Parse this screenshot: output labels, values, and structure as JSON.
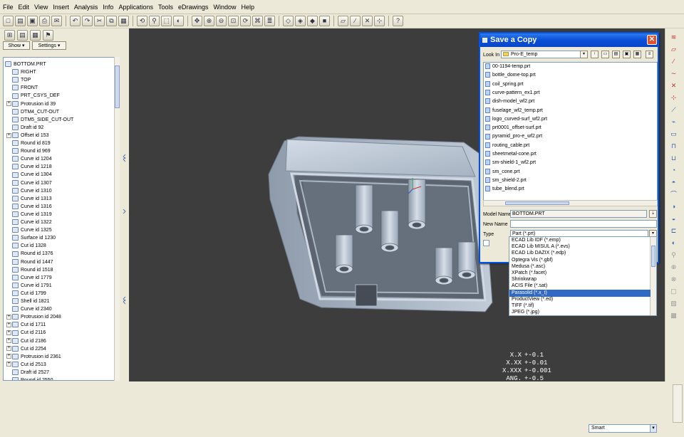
{
  "menu": [
    "File",
    "Edit",
    "View",
    "Insert",
    "Analysis",
    "Info",
    "Applications",
    "Tools",
    "eDrawings",
    "Window",
    "Help"
  ],
  "toolbar": {
    "icons": [
      "new-icon",
      "open-icon",
      "save-icon",
      "print-icon",
      "email-icon",
      "undo-icon",
      "redo-icon",
      "cut-icon",
      "copy-icon",
      "paste-icon",
      "regenerate-icon",
      "find-icon",
      "select-icon",
      "repaint-icon",
      "spin-center-icon",
      "zoom-in-icon",
      "zoom-out-icon",
      "refit-icon",
      "orient-icon",
      "saved-views-icon",
      "layers-icon",
      "wireframe-icon",
      "hidden-line-icon",
      "no-hidden-icon",
      "shading-icon",
      "datum-planes-icon",
      "datum-axes-icon",
      "datum-points-icon",
      "csys-icon",
      "whats-this-icon"
    ],
    "glyphs": [
      "□",
      "▤",
      "▣",
      "⎙",
      "✉",
      "↶",
      "↷",
      "✂",
      "⧉",
      "▦",
      "⟲",
      "⚲",
      "⬚",
      "◐",
      "✥",
      "⊕",
      "⊖",
      "⊡",
      "⟳",
      "⌘",
      "≣",
      "◇",
      "◈",
      "◆",
      "■",
      "▱",
      "∕",
      "✕",
      "⊹",
      "?"
    ]
  },
  "left_tools": [
    "⊞",
    "▤",
    "▦",
    "⚑"
  ],
  "show_button": "Show ▾",
  "settings_button": "Settings ▾",
  "model_tree": [
    {
      "t": "BOTTOM.PRT",
      "exp": ""
    },
    {
      "t": "RIGHT",
      "exp": ""
    },
    {
      "t": "TOP",
      "exp": ""
    },
    {
      "t": "FRONT",
      "exp": ""
    },
    {
      "t": "PRT_CSYS_DEF",
      "exp": ""
    },
    {
      "t": "Protrusion id 39",
      "exp": "+"
    },
    {
      "t": "DTM4_CUT-OUT",
      "exp": ""
    },
    {
      "t": "DTM5_SIDE_CUT-OUT",
      "exp": ""
    },
    {
      "t": "Draft id 92",
      "exp": ""
    },
    {
      "t": "Offset id 153",
      "exp": "+"
    },
    {
      "t": "Round id 819",
      "exp": ""
    },
    {
      "t": "Round id 969",
      "exp": ""
    },
    {
      "t": "Curve id 1204",
      "exp": ""
    },
    {
      "t": "Curve id 1218",
      "exp": ""
    },
    {
      "t": "Curve id 1304",
      "exp": ""
    },
    {
      "t": "Curve id 1307",
      "exp": ""
    },
    {
      "t": "Curve id 1310",
      "exp": ""
    },
    {
      "t": "Curve id 1313",
      "exp": ""
    },
    {
      "t": "Curve id 1316",
      "exp": ""
    },
    {
      "t": "Curve id 1319",
      "exp": ""
    },
    {
      "t": "Curve id 1322",
      "exp": ""
    },
    {
      "t": "Curve id 1325",
      "exp": ""
    },
    {
      "t": "Surface id 1230",
      "exp": ""
    },
    {
      "t": "Cut id 1328",
      "exp": ""
    },
    {
      "t": "Round id 1376",
      "exp": ""
    },
    {
      "t": "Round id 1447",
      "exp": ""
    },
    {
      "t": "Round id 1518",
      "exp": ""
    },
    {
      "t": "Curve id 1779",
      "exp": ""
    },
    {
      "t": "Curve id 1791",
      "exp": ""
    },
    {
      "t": "Cut id 1799",
      "exp": ""
    },
    {
      "t": "Shell id 1821",
      "exp": ""
    },
    {
      "t": "Curve id 2340",
      "exp": ""
    },
    {
      "t": "Protrusion id 2048",
      "exp": "+"
    },
    {
      "t": "Cut id 1711",
      "exp": "+"
    },
    {
      "t": "Cut id 2116",
      "exp": "+"
    },
    {
      "t": "Cut id 2186",
      "exp": "+"
    },
    {
      "t": "Cut id 2254",
      "exp": "+"
    },
    {
      "t": "Protrusion id 2361",
      "exp": "+"
    },
    {
      "t": "Cut id 2513",
      "exp": "+"
    },
    {
      "t": "Draft id 2527",
      "exp": ""
    },
    {
      "t": "Round id 2550",
      "exp": ""
    }
  ],
  "dialog": {
    "title": "Save a Copy",
    "look_in_label": "Look In",
    "look_in_value": "Pro-E_temp",
    "files": [
      "00-1194-temp.prt",
      "bottle_dome-top.prt",
      "coil_spring.prt",
      "curve-pattern_ex1.prt",
      "dish-model_wf2.prt",
      "fuselage_wf2_temp.prt",
      "logo_curved-surf_wf2.prt",
      "prt0001_offset-surf.prt",
      "pyramid_pro-e_wf2.prt",
      "routing_cable.prt",
      "sheetmetal-cone.prt",
      "sm-shield-1_wf2.prt",
      "sm_cone.prt",
      "sm_shield-2.prt",
      "tube_blend.prt"
    ],
    "model_name_label": "Model Name",
    "model_name_value": "BOTTOM.PRT",
    "new_name_label": "New Name",
    "new_name_value": "",
    "type_label": "Type",
    "type_value": "Part (*.prt)",
    "type_options": [
      "ECAD Lib IDF (*.emp)",
      "ECAD Lib MISUL A (*.evs)",
      "ECAD Lib DAZIX (*.edp)",
      "Optegra Vis (*.gbf)",
      "Medusa (*.asc)",
      "XPatch (*.facet)",
      "Shrinkwrap",
      "ACIS File (*.sat)",
      "Parasolid (*.x_t)",
      "ProductView (*.ed)",
      "TIFF (*.tif)",
      "JPEG (*.jpg)"
    ],
    "selected_option": 8
  },
  "tolerances": [
    {
      "k": "X.X",
      "v": "+-0.1"
    },
    {
      "k": "X.XX",
      "v": "+-0.01"
    },
    {
      "k": "X.XXX",
      "v": "+-0.001"
    },
    {
      "k": "ANG.",
      "v": "+-0.5"
    }
  ],
  "status": {
    "filter": "Smart"
  },
  "colors": {
    "viewport": "#3d3d3d",
    "part": "#b8c3d0",
    "dialog_title": "#0b4fd8",
    "selection": "#316ac5"
  }
}
